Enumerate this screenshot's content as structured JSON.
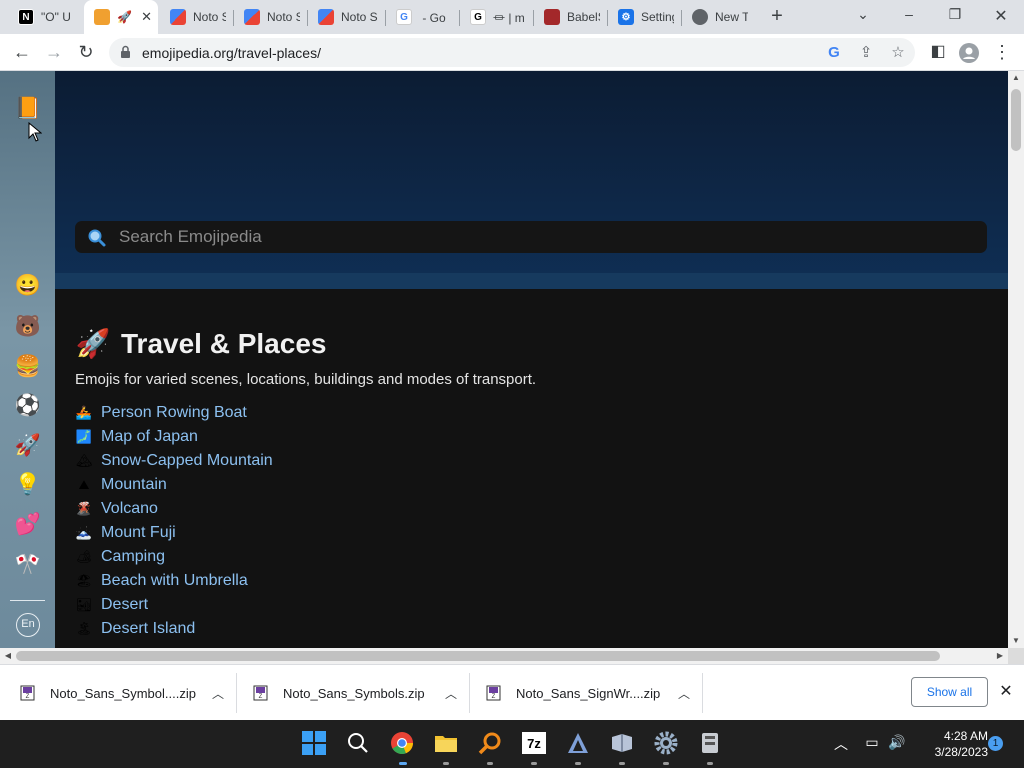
{
  "browser": {
    "tabs": [
      {
        "title": "\"O\" U",
        "active": false,
        "icon": "notion-icon"
      },
      {
        "title": "🚀",
        "active": true,
        "icon": "emojipedia-icon"
      },
      {
        "title": "Noto S",
        "active": false,
        "icon": "google-fonts-icon"
      },
      {
        "title": "Noto S",
        "active": false,
        "icon": "google-fonts-icon"
      },
      {
        "title": "Noto S",
        "active": false,
        "icon": "google-fonts-icon"
      },
      {
        "title": "⃞ - Go",
        "active": false,
        "icon": "google-icon"
      },
      {
        "title": "⏛ | m",
        "active": false,
        "icon": "g-icon"
      },
      {
        "title": "BabelS",
        "active": false,
        "icon": "babelstone-icon"
      },
      {
        "title": "Settings",
        "active": false,
        "icon": "settings-icon"
      },
      {
        "title": "New T",
        "active": false,
        "icon": "chrome-icon"
      }
    ],
    "url": "emojipedia.org/travel-places/"
  },
  "sidebar": {
    "icons": [
      {
        "name": "emojipedia-logo-icon",
        "glyph": "📙"
      },
      {
        "name": "smileys-category-icon",
        "glyph": "😀"
      },
      {
        "name": "animals-category-icon",
        "glyph": "🐻"
      },
      {
        "name": "food-category-icon",
        "glyph": "🍔"
      },
      {
        "name": "activities-category-icon",
        "glyph": "⚽"
      },
      {
        "name": "travel-category-icon",
        "glyph": "🚀"
      },
      {
        "name": "objects-category-icon",
        "glyph": "💡"
      },
      {
        "name": "symbols-category-icon",
        "glyph": "💕"
      },
      {
        "name": "flags-category-icon",
        "glyph": "🎌"
      }
    ],
    "language": "En"
  },
  "search": {
    "placeholder": "Search Emojipedia"
  },
  "category": {
    "emoji": "🚀",
    "title": "Travel & Places",
    "description": "Emojis for varied scenes, locations, buildings and modes of transport.",
    "items": [
      {
        "emoji": "🚣",
        "label": "Person Rowing Boat"
      },
      {
        "emoji": "🗾",
        "label": "Map of Japan"
      },
      {
        "emoji": "🏔",
        "label": "Snow-Capped Mountain"
      },
      {
        "emoji": "⛰",
        "label": "Mountain"
      },
      {
        "emoji": "🌋",
        "label": "Volcano"
      },
      {
        "emoji": "🗻",
        "label": "Mount Fuji"
      },
      {
        "emoji": "🏕",
        "label": "Camping"
      },
      {
        "emoji": "🏖",
        "label": "Beach with Umbrella"
      },
      {
        "emoji": "🏜",
        "label": "Desert"
      },
      {
        "emoji": "🏝",
        "label": "Desert Island"
      }
    ]
  },
  "downloads": {
    "items": [
      {
        "filename": "Noto_Sans_Symbol....zip"
      },
      {
        "filename": "Noto_Sans_Symbols.zip"
      },
      {
        "filename": "Noto_Sans_SignWr....zip"
      }
    ],
    "show_all": "Show all"
  },
  "taskbar": {
    "time": "4:28 AM",
    "date": "3/28/2023",
    "notification_count": "1"
  },
  "colors": {
    "page_bg": "#121212",
    "hero_bg": "#0f2f55",
    "link": "#8cc0f0",
    "chrome_bg": "#dee1e6"
  }
}
